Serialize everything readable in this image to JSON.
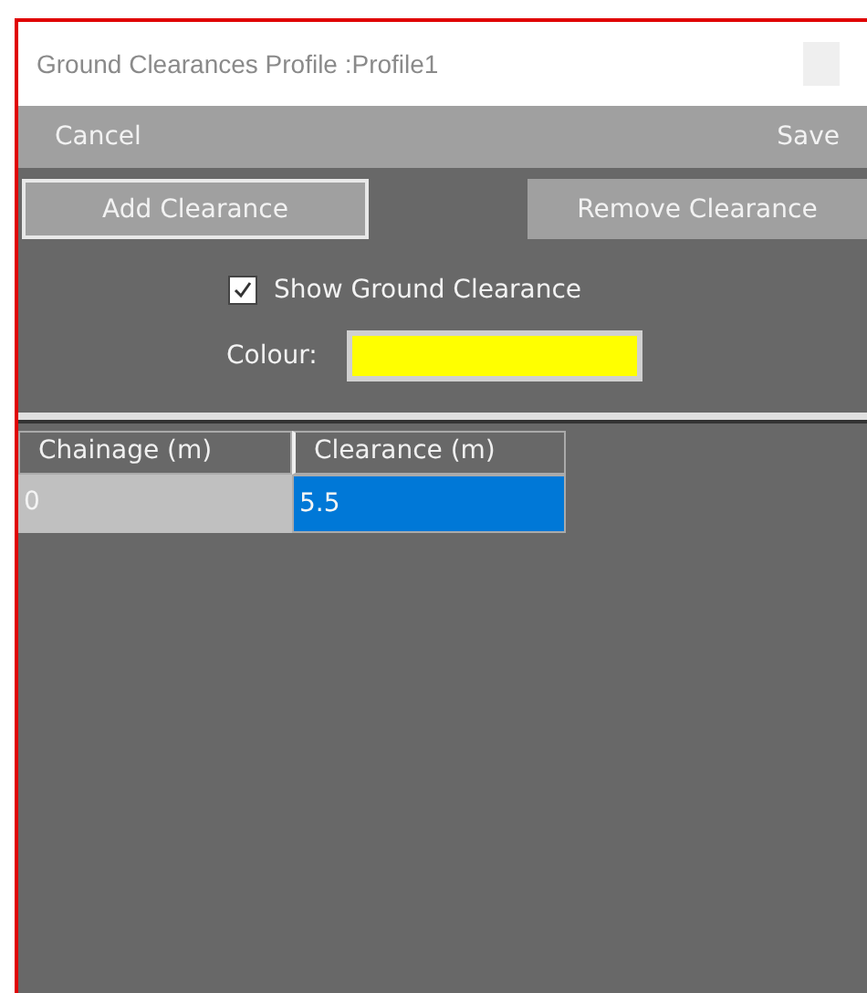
{
  "window": {
    "title": "Ground Clearances Profile :Profile1"
  },
  "toolbar": {
    "left": "Cancel",
    "right": "Save"
  },
  "buttons": [
    {
      "label": "Add Clearance",
      "kind": "outlined"
    },
    {
      "label": "Remove Clearance",
      "kind": "flat"
    }
  ],
  "show_ground_clearance": {
    "label": "Show Ground Clearance",
    "checked": true
  },
  "colour": {
    "label": "Colour:",
    "color": "#ffff00"
  },
  "table": {
    "columns": [
      "Chainage (m)",
      "Clearance (m)"
    ],
    "rows": [
      {
        "cells": [
          {
            "text": "0",
            "selected": false
          },
          {
            "text": "5.5",
            "selected": true
          }
        ]
      }
    ]
  }
}
